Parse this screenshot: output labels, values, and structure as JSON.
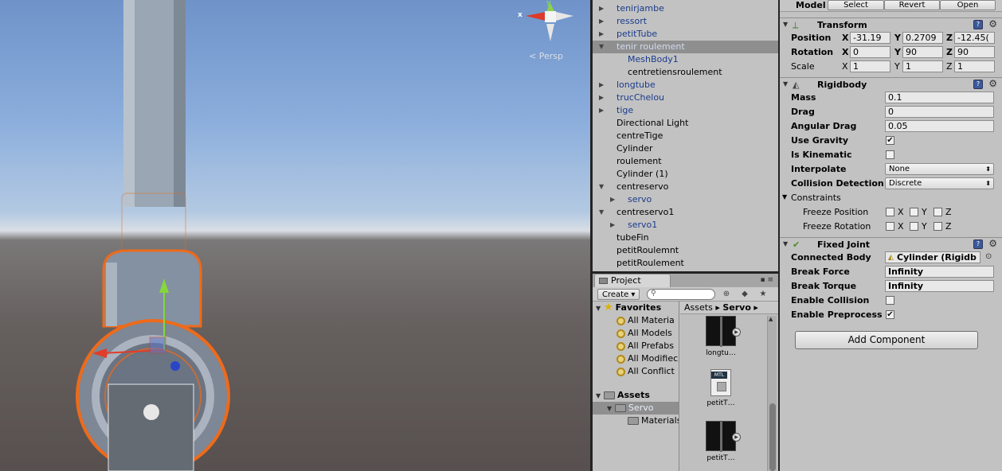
{
  "scene": {
    "persp_label": "Persp",
    "gizmo_x_label": "x",
    "gizmo_y_label": "y"
  },
  "hierarchy": {
    "items": [
      {
        "label": "tenirjambe",
        "prefab": true,
        "arrow": "▶",
        "depth": 0
      },
      {
        "label": "ressort",
        "prefab": true,
        "arrow": "▶",
        "depth": 0
      },
      {
        "label": "petitTube",
        "prefab": true,
        "arrow": "▶",
        "depth": 0
      },
      {
        "label": "tenir roulement",
        "prefab": true,
        "arrow": "▼",
        "depth": 0,
        "selected": true
      },
      {
        "label": "MeshBody1",
        "prefab": true,
        "arrow": "",
        "depth": 1
      },
      {
        "label": "centretiensroulement",
        "prefab": false,
        "arrow": "",
        "depth": 1
      },
      {
        "label": "longtube",
        "prefab": true,
        "arrow": "▶",
        "depth": 0
      },
      {
        "label": "trucChelou",
        "prefab": true,
        "arrow": "▶",
        "depth": 0
      },
      {
        "label": "tige",
        "prefab": true,
        "arrow": "▶",
        "depth": 0
      },
      {
        "label": "Directional Light",
        "prefab": false,
        "arrow": "",
        "depth": 0
      },
      {
        "label": "centreTige",
        "prefab": false,
        "arrow": "",
        "depth": 0
      },
      {
        "label": "Cylinder",
        "prefab": false,
        "arrow": "",
        "depth": 0
      },
      {
        "label": "roulement",
        "prefab": false,
        "arrow": "",
        "depth": 0
      },
      {
        "label": "Cylinder (1)",
        "prefab": false,
        "arrow": "",
        "depth": 0
      },
      {
        "label": "centreservo",
        "prefab": false,
        "arrow": "▼",
        "depth": 0
      },
      {
        "label": "servo",
        "prefab": true,
        "arrow": "▶",
        "depth": 1
      },
      {
        "label": "centreservo1",
        "prefab": false,
        "arrow": "▼",
        "depth": 0
      },
      {
        "label": "servo1",
        "prefab": true,
        "arrow": "▶",
        "depth": 1
      },
      {
        "label": "tubeFin",
        "prefab": false,
        "arrow": "",
        "depth": 0
      },
      {
        "label": "petitRoulemnt",
        "prefab": false,
        "arrow": "",
        "depth": 0
      },
      {
        "label": "petitRoulement",
        "prefab": false,
        "arrow": "",
        "depth": 0
      }
    ]
  },
  "project": {
    "tab_label": "Project",
    "create_label": "Create ▾",
    "favorites_label": "Favorites",
    "favorites": [
      "All Materia",
      "All Models",
      "All Prefabs",
      "All Modifiec",
      "All Conflict"
    ],
    "assets_label": "Assets",
    "servo_label": "Servo",
    "materials_label": "Materials",
    "crumb_root": "Assets",
    "crumb_current": "Servo",
    "asset_items": [
      {
        "label": "longtu…",
        "kind": "model"
      },
      {
        "label": "petitT…",
        "kind": "material",
        "tag": "MTL"
      },
      {
        "label": "petitT…",
        "kind": "model"
      }
    ]
  },
  "inspector": {
    "model_label": "Model",
    "model_buttons": [
      "Select",
      "Revert",
      "Open"
    ],
    "transform": {
      "title": "Transform",
      "position_label": "Position",
      "rotation_label": "Rotation",
      "scale_label": "Scale",
      "position": {
        "x": "-31.19",
        "y": "0.2709",
        "z": "-12.45("
      },
      "rotation": {
        "x": "0",
        "y": "90",
        "z": "90"
      },
      "scale": {
        "x": "1",
        "y": "1",
        "z": "1"
      }
    },
    "axis_labels": {
      "x": "X",
      "y": "Y",
      "z": "Z"
    },
    "rigidbody": {
      "title": "Rigidbody",
      "mass_label": "Mass",
      "mass": "0.1",
      "drag_label": "Drag",
      "drag": "0",
      "angular_drag_label": "Angular Drag",
      "angular_drag": "0.05",
      "use_gravity_label": "Use Gravity",
      "use_gravity": true,
      "is_kinematic_label": "Is Kinematic",
      "is_kinematic": false,
      "interpolate_label": "Interpolate",
      "interpolate": "None",
      "collision_label": "Collision Detection",
      "collision": "Discrete",
      "constraints_label": "Constraints",
      "freeze_position_label": "Freeze Position",
      "freeze_rotation_label": "Freeze Rotation"
    },
    "fixed_joint": {
      "title": "Fixed Joint",
      "connected_body_label": "Connected Body",
      "connected_body": "Cylinder (Rigidb",
      "break_force_label": "Break Force",
      "break_force": "Infinity",
      "break_torque_label": "Break Torque",
      "break_torque": "Infinity",
      "enable_collision_label": "Enable Collision",
      "enable_collision": false,
      "enable_preprocessing_label": "Enable Preprocess",
      "enable_preprocessing": true
    },
    "add_component_label": "Add Component"
  }
}
